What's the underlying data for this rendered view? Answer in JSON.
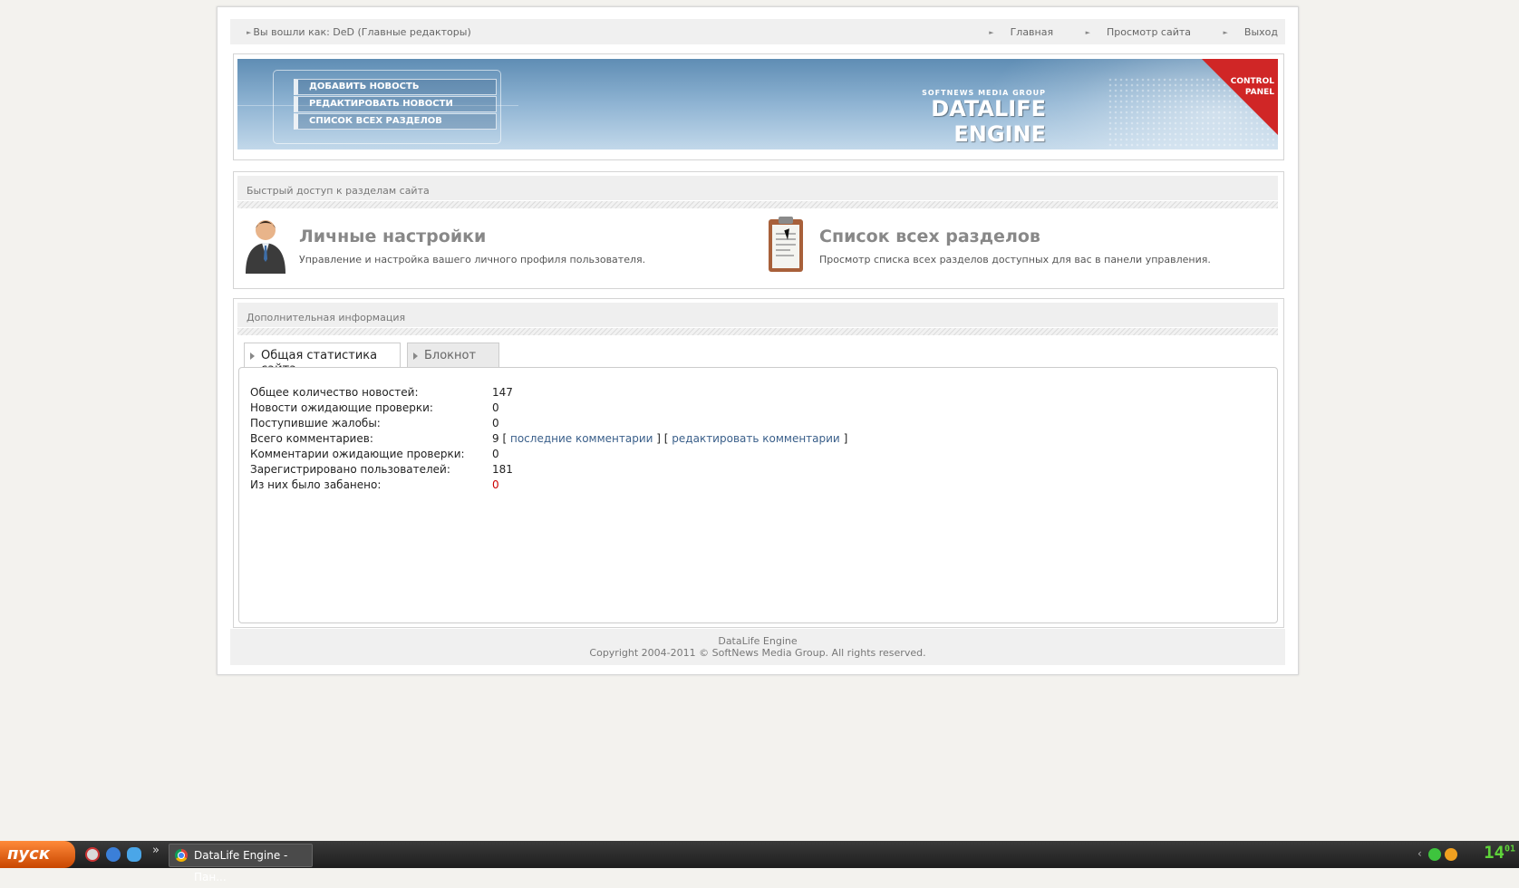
{
  "topbar": {
    "user": "Вы вошли как: DeD (Главные редакторы)",
    "links": [
      "Главная",
      "Просмотр сайта",
      "Выход"
    ]
  },
  "banner": {
    "menu": [
      "ДОБАВИТЬ НОВОСТЬ",
      "РЕДАКТИРОВАТЬ НОВОСТИ",
      "СПИСОК ВСЕХ РАЗДЕЛОВ"
    ],
    "subtitle": "SOFTNEWS MEDIA GROUP",
    "logo": "DATALIFE ENGINE",
    "corner_line1": "CONTROL",
    "corner_line2": "PANEL"
  },
  "quick": {
    "heading": "Быстрый доступ к разделам сайта",
    "items": [
      {
        "title": "Личные настройки",
        "desc": "Управление и настройка вашего личного профиля пользователя."
      },
      {
        "title": "Список всех разделов",
        "desc": "Просмотр списка всех разделов доступных для вас в панели управления."
      }
    ]
  },
  "info": {
    "heading": "Дополнительная информация",
    "tabs": [
      "Общая статистика сайта",
      "Блокнот"
    ],
    "stats": [
      {
        "label": "Общее количество новостей:",
        "value": "147"
      },
      {
        "label": "Новости ожидающие проверки:",
        "value": "0"
      },
      {
        "label": "Поступившие жалобы:",
        "value": "0"
      },
      {
        "label": "Всего комментариев:",
        "value": "9"
      },
      {
        "label": "Комментарии ожидающие проверки:",
        "value": "0"
      },
      {
        "label": "Зарегистрировано пользователей:",
        "value": "181"
      },
      {
        "label": "Из них было забанено:",
        "value": "0"
      }
    ],
    "comment_links": {
      "open": "[",
      "latest": "последние комментарии",
      "mid": "] [",
      "edit": "редактировать комментарии",
      "close": "]"
    }
  },
  "footer": {
    "line1": "DataLife Engine",
    "line2": "Copyright 2004-2011 © SoftNews Media Group. All rights reserved."
  },
  "taskbar": {
    "start": "пуск",
    "task": "DataLife Engine - Пан...",
    "clock_hour": "14",
    "clock_min": "01"
  },
  "colors": {
    "accent_red": "#d02626",
    "link": "#3a5f8a",
    "banned": "#cc0000",
    "clock": "#5fd33a"
  }
}
